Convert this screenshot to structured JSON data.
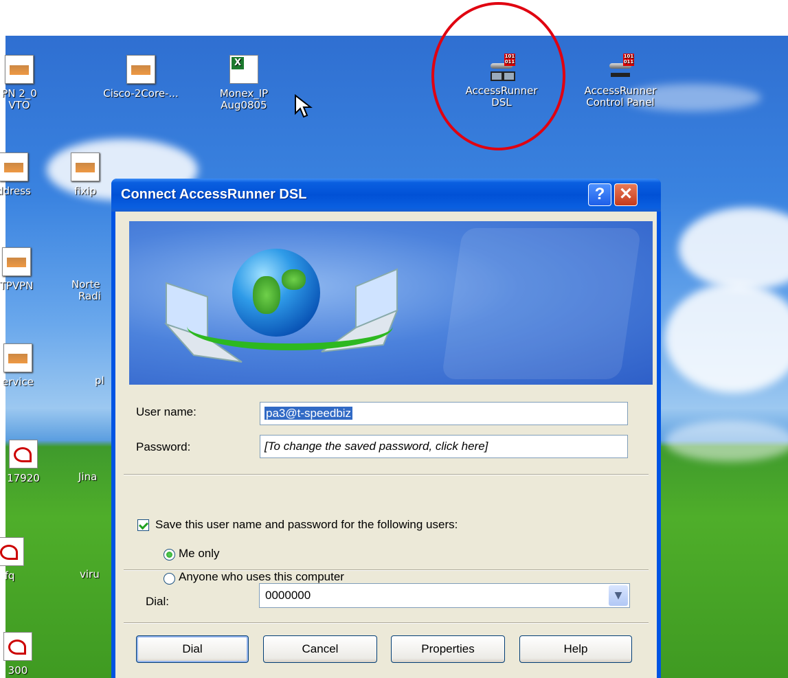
{
  "desktop": {
    "icons": [
      {
        "label_lines": [
          "PN 2_0",
          "VTO"
        ],
        "icon": "vpn-icon"
      },
      {
        "label_lines": [
          "Cisco-2Core-..."
        ],
        "icon": "document-icon"
      },
      {
        "label_lines": [
          "Monex_IP",
          "Aug0805"
        ],
        "icon": "excel-icon"
      },
      {
        "label_lines": [
          "AccessRunner",
          "DSL"
        ],
        "icon": "network-connection-icon"
      },
      {
        "label_lines": [
          "AccessRunner",
          "Control Panel"
        ],
        "icon": "control-panel-icon"
      },
      {
        "label_lines": [
          "ddress"
        ],
        "icon": "document-icon"
      },
      {
        "label_lines": [
          "fixip"
        ],
        "icon": "document-icon"
      },
      {
        "label_lines": [
          "TPVPN"
        ],
        "icon": "document-icon"
      },
      {
        "label_lines": [
          "Norte",
          "Radi"
        ],
        "icon": "folder-icon"
      },
      {
        "label_lines": [
          "ervice"
        ],
        "icon": "document-icon"
      },
      {
        "label_lines": [
          "pl"
        ],
        "icon": "document-icon"
      },
      {
        "label_lines": [
          "17920"
        ],
        "icon": "pdf-icon"
      },
      {
        "label_lines": [
          "Jina"
        ],
        "icon": "app-icon"
      },
      {
        "label_lines": [
          "fq"
        ],
        "icon": "pdf-icon"
      },
      {
        "label_lines": [
          "viru"
        ],
        "icon": "document-icon"
      },
      {
        "label_lines": [
          "300"
        ],
        "icon": "pdf-icon"
      }
    ],
    "highlight_color": "#e00010"
  },
  "dialog": {
    "title": "Connect AccessRunner DSL",
    "help_glyph": "?",
    "close_glyph": "✕",
    "user_name_label": "User name:",
    "user_name_value": "pa3@t-speedbiz",
    "password_label": "Password:",
    "password_placeholder": "[To change the saved password, click here]",
    "save_label": "Save this user name and password for the following users:",
    "save_checked": true,
    "radio_me_label": "Me only",
    "radio_anyone_label": "Anyone who uses this computer",
    "selected_radio": "Me only",
    "dial_label": "Dial:",
    "dial_value": "0000000",
    "buttons": {
      "dial": "Dial",
      "cancel": "Cancel",
      "properties": "Properties",
      "help": "Help"
    },
    "colors": {
      "titlebar": "#0151d6",
      "client": "#ece9d8",
      "close": "#c43a1c"
    }
  }
}
